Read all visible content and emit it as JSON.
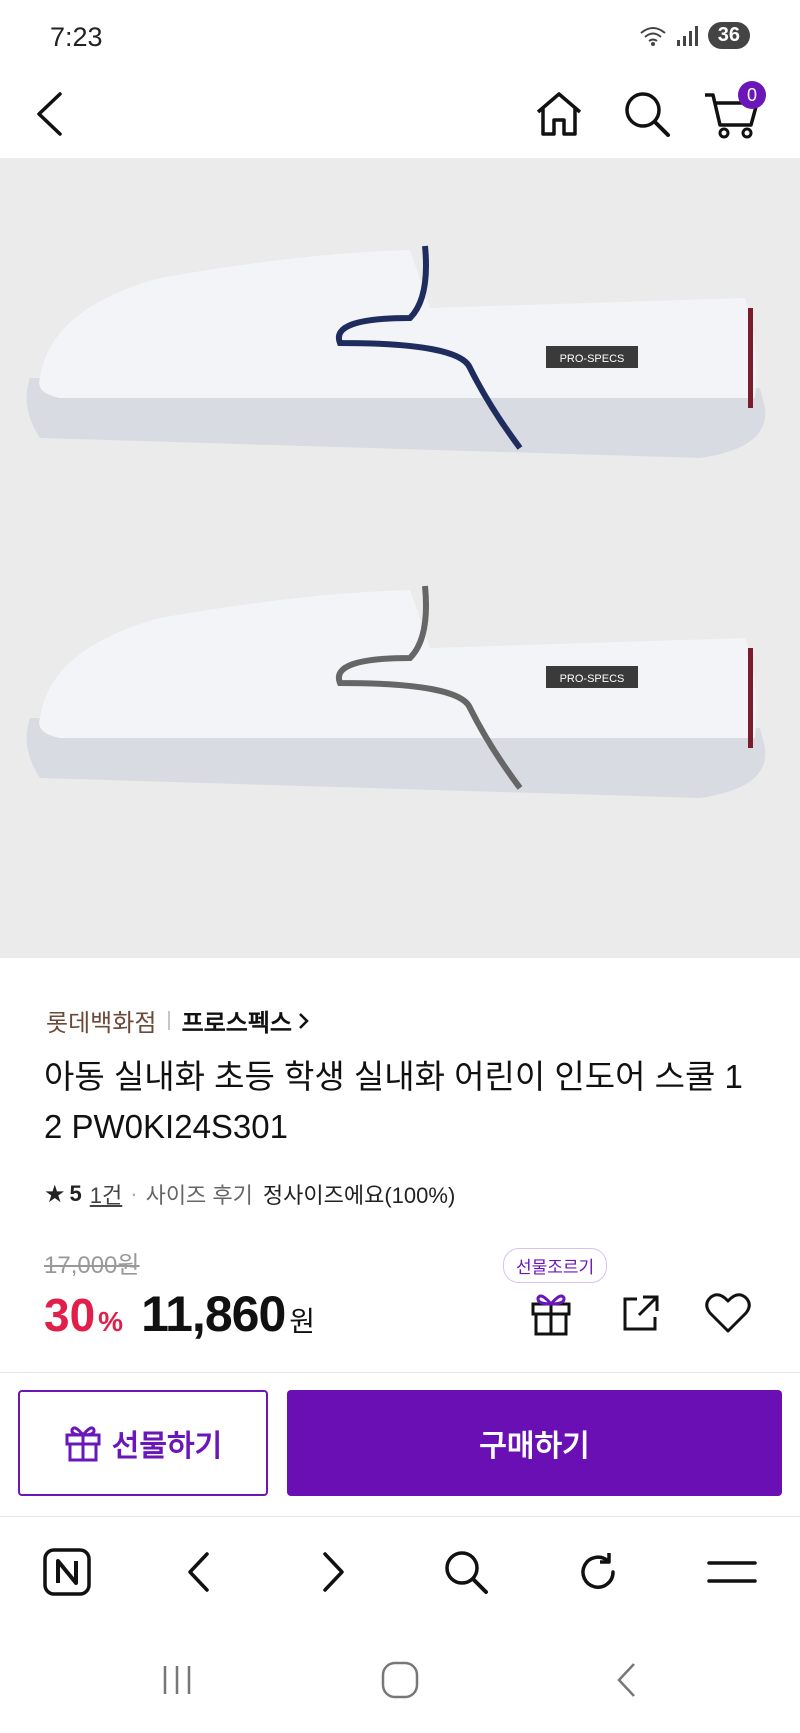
{
  "status_bar": {
    "time": "7:23",
    "battery": "36"
  },
  "header": {
    "cart_count": "0"
  },
  "product_image": {
    "brand_tag": "PRO-SPECS",
    "tag2": "PRO-SPECS"
  },
  "product": {
    "store": "롯데백화점",
    "brand": "프로스펙스",
    "title": "아동 실내화 초등 학생 실내화 어린이 인도어 스쿨 1 2 PW0KI24S301",
    "rating": "5",
    "review_count": "1건",
    "size_label": "사이즈 후기",
    "size_text": "정사이즈에요(100%)",
    "original_price": "17,000원",
    "discount": "30",
    "discount_unit": "%",
    "price": "11,860",
    "price_unit": "원"
  },
  "actions": {
    "gift_tooltip": "선물조르기"
  },
  "buttons": {
    "gift": "선물하기",
    "buy": "구매하기"
  },
  "colors": {
    "accent": "#6a0fb3",
    "discount": "#e0204a"
  },
  "icons": [
    "back-icon",
    "home-icon",
    "search-icon",
    "cart-icon",
    "gift-icon",
    "share-icon",
    "heart-icon"
  ]
}
